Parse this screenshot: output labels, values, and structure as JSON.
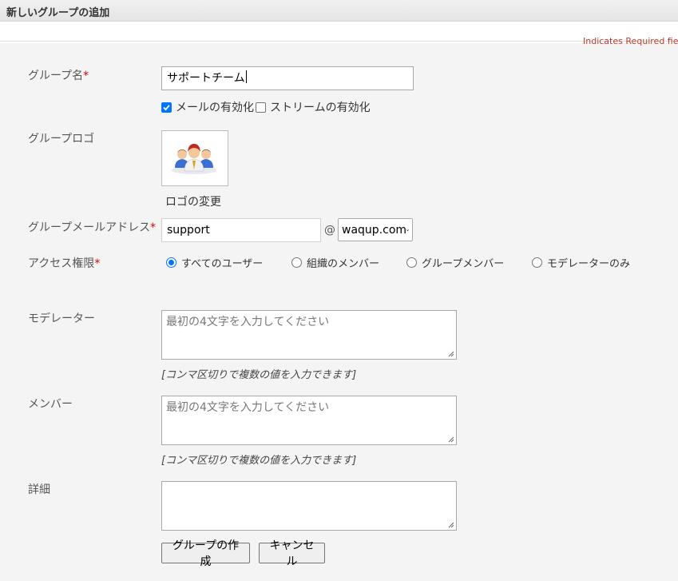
{
  "header": {
    "title": "新しいグループの追加"
  },
  "required_note": "Indicates Required fields",
  "form": {
    "group_name": {
      "label": "グループ名",
      "required_mark": "*",
      "value": "サポートチーム"
    },
    "options": [
      {
        "label": "メールの有効化",
        "checked": true
      },
      {
        "label": "ストリームの有効化",
        "checked": false
      }
    ],
    "logo": {
      "label": "グループロゴ",
      "change_link": "ロゴの変更"
    },
    "group_email": {
      "label": "グループメールアドレス",
      "required_mark": "*",
      "value": "support",
      "at": "@",
      "domain": "waqup.com"
    },
    "access": {
      "label": "アクセス権限",
      "required_mark": "*",
      "options": [
        {
          "label": "すべてのユーザー",
          "checked": true
        },
        {
          "label": "組織のメンバー",
          "checked": false
        },
        {
          "label": "グループメンバー",
          "checked": false
        },
        {
          "label": "モデレーターのみ",
          "checked": false
        }
      ]
    },
    "moderators": {
      "label": "モデレーター",
      "placeholder": "最初の4文字を入力してください",
      "hint": "[コンマ区切りで複数の値を入力できます]"
    },
    "members": {
      "label": "メンバー",
      "placeholder": "最初の4文字を入力してください",
      "hint": "[コンマ区切りで複数の値を入力できます]"
    },
    "details": {
      "label": "詳細",
      "value": ""
    }
  },
  "buttons": {
    "create": "グループの作成",
    "cancel": "キャンセル"
  },
  "colors": {
    "required": "#dd0000",
    "accent": "#0075ff",
    "panel": "#f4f4f4"
  }
}
